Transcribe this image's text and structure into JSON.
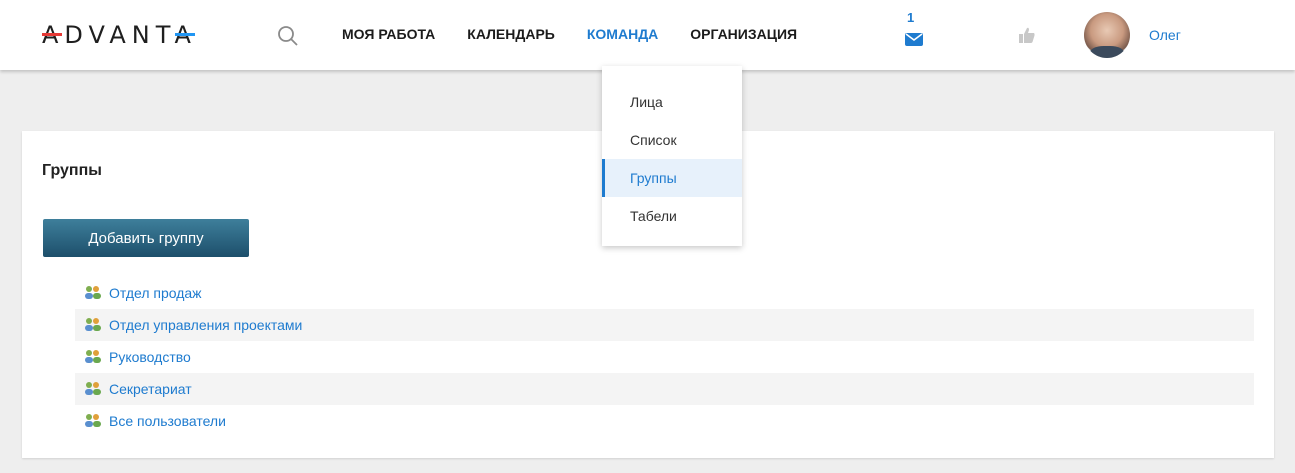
{
  "logo": {
    "text": "ADVANTA"
  },
  "nav": {
    "items": [
      {
        "label": "МОЯ РАБОТА",
        "active": false
      },
      {
        "label": "КАЛЕНДАРЬ",
        "active": false
      },
      {
        "label": "КОМАНДА",
        "active": true
      },
      {
        "label": "ОРГАНИЗАЦИЯ",
        "active": false
      }
    ]
  },
  "notifications": {
    "messages_count": "1"
  },
  "user": {
    "name": "Олег"
  },
  "dropdown": {
    "items": [
      {
        "label": "Лица",
        "active": false
      },
      {
        "label": "Список",
        "active": false
      },
      {
        "label": "Группы",
        "active": true
      },
      {
        "label": "Табели",
        "active": false
      }
    ]
  },
  "page": {
    "title": "Группы",
    "add_button_label": "Добавить группу",
    "groups": [
      {
        "name": "Отдел продаж"
      },
      {
        "name": "Отдел управления проектами"
      },
      {
        "name": "Руководство"
      },
      {
        "name": "Секретариат"
      },
      {
        "name": "Все пользователи"
      }
    ]
  },
  "colors": {
    "accent": "#1e7bcf",
    "button": "#2a6482",
    "logo_red": "#e53935",
    "logo_blue": "#2196f3"
  },
  "icons": {
    "search": "search-icon",
    "messages": "envelope-icon",
    "like": "thumbs-up-icon",
    "group": "users-group-icon"
  }
}
